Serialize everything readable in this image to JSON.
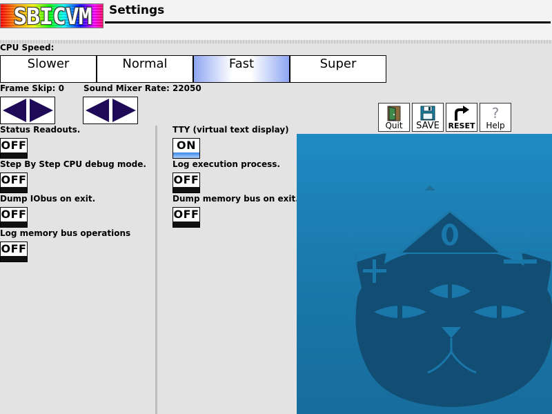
{
  "header": {
    "logo_text": "SBICVM",
    "title": "Settings"
  },
  "cpu_speed": {
    "label": "CPU Speed:",
    "options": [
      "Slower",
      "Normal",
      "Fast",
      "Super"
    ],
    "selected": "Fast"
  },
  "frame_skip": {
    "label": "Frame Skip: 0",
    "value": 0
  },
  "sound_mixer": {
    "label": "Sound Mixer Rate: 22050",
    "value": 22050
  },
  "options_left": [
    {
      "label": "Status Readouts.",
      "state": "OFF"
    },
    {
      "label": "Step By Step CPU debug mode.",
      "state": "OFF"
    },
    {
      "label": "Dump IObus on exit.",
      "state": "OFF"
    },
    {
      "label": "Log memory bus operations",
      "state": "OFF"
    }
  ],
  "options_right": [
    {
      "label": "TTY (virtual text display)",
      "state": "ON"
    },
    {
      "label": "Log execution process.",
      "state": "OFF"
    },
    {
      "label": "Dump memory bus on exit.",
      "state": "OFF"
    }
  ],
  "toolbar": {
    "quit": "Quit",
    "save": "SAVE",
    "reset": "RESET",
    "help": "Help",
    "help_glyph": "?"
  },
  "preview": {
    "mascot_glyph": "O"
  },
  "colors": {
    "selected_gradient": "#8ea6f3",
    "arrow_fill": "#1f0a57",
    "on_bar": "#3b86e6",
    "preview_bg": "#1f8ac2",
    "mascot": "#124e74"
  },
  "icons": [
    "door-icon",
    "floppy-disk-icon",
    "reset-arrow-icon",
    "question-mark-icon",
    "left-arrow-icon",
    "right-arrow-icon"
  ]
}
